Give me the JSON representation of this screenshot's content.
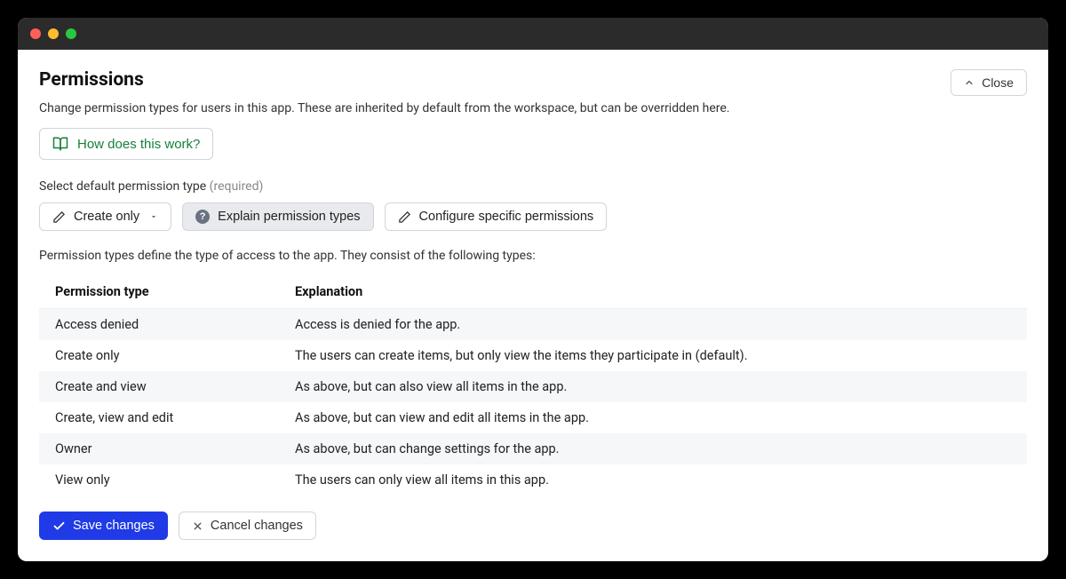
{
  "header": {
    "title": "Permissions",
    "close": "Close",
    "subtitle": "Change permission types for users in this app. These are inherited by default from the workspace, but can be overridden here.",
    "help_link": "How does this work?"
  },
  "selector": {
    "label": "Select default permission type",
    "required": "(required)",
    "create_only": "Create only",
    "explain": "Explain permission types",
    "configure": "Configure specific permissions"
  },
  "types_desc": "Permission types define the type of access to the app. They consist of the following types:",
  "table": {
    "col_type": "Permission type",
    "col_expl": "Explanation",
    "rows": [
      {
        "type": "Access denied",
        "expl": "Access is denied for the app."
      },
      {
        "type": "Create only",
        "expl": "The users can create items, but only view the items they participate in (default)."
      },
      {
        "type": "Create and view",
        "expl": "As above, but can also view all items in the app."
      },
      {
        "type": "Create, view and edit",
        "expl": "As above, but can view and edit all items in the app."
      },
      {
        "type": "Owner",
        "expl": "As above, but can change settings for the app."
      },
      {
        "type": "View only",
        "expl": "The users can only view all items in this app."
      }
    ]
  },
  "footer": {
    "save": "Save changes",
    "cancel": "Cancel changes"
  }
}
